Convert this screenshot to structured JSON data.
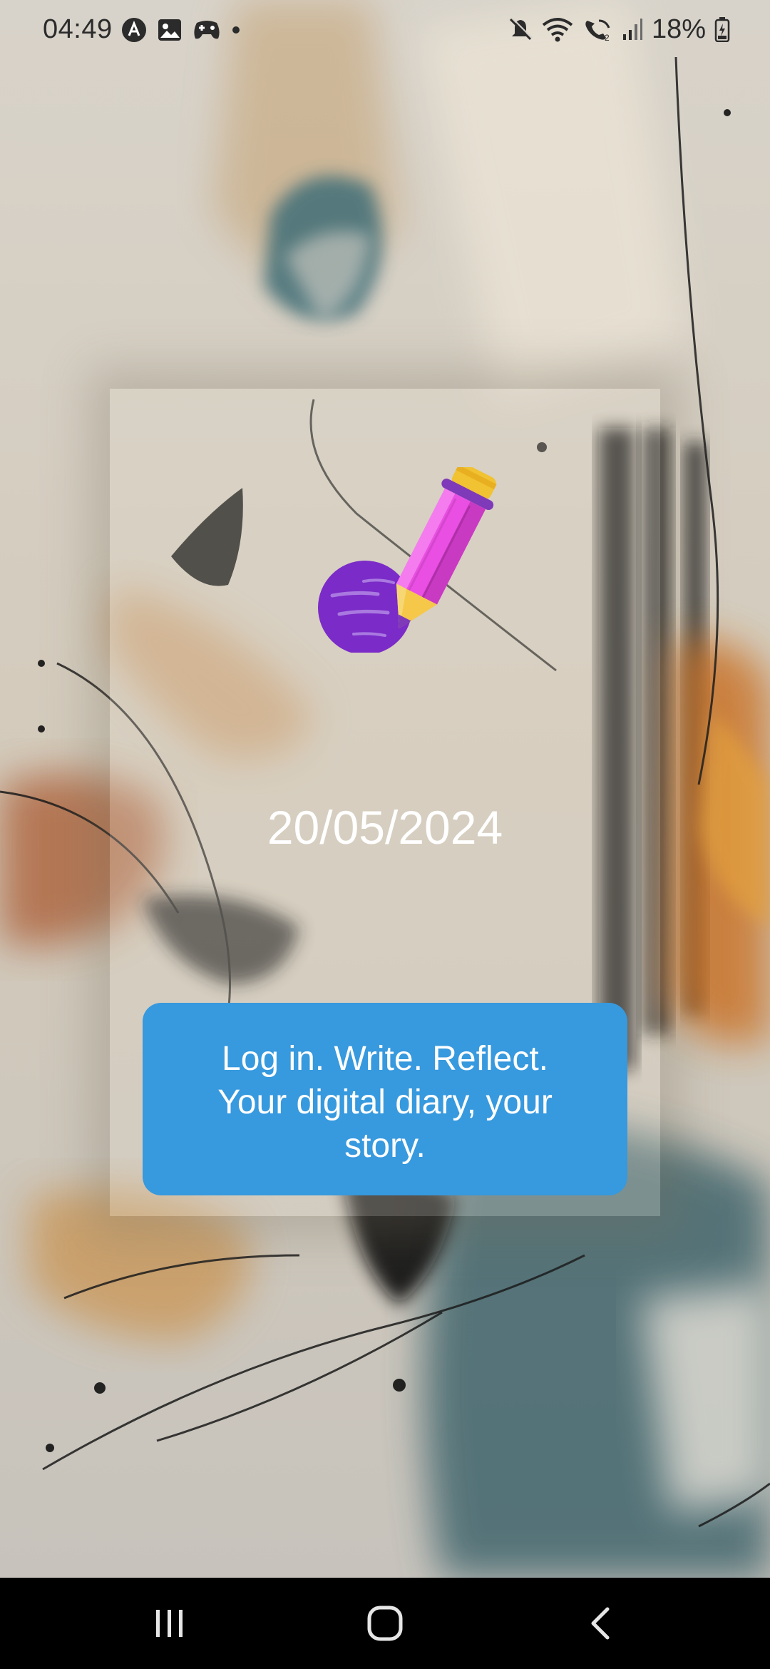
{
  "status_bar": {
    "time": "04:49",
    "left_icons": [
      "app-notification-icon",
      "gallery-icon",
      "game-controller-icon",
      "more-dot-icon"
    ],
    "right_icons": [
      "mute-icon",
      "wifi-icon",
      "wifi-calling-icon",
      "signal-icon",
      "battery-icon"
    ],
    "battery_percent": "18%"
  },
  "main": {
    "date": "20/05/2024",
    "tagline": "Log in. Write. Reflect. Your digital diary, your story.",
    "accent_color": "#3799de",
    "illustration": [
      "purple-ball-icon",
      "pencil-icon"
    ]
  },
  "nav_bar": {
    "buttons": [
      "recent-apps-icon",
      "home-icon",
      "back-icon"
    ]
  }
}
